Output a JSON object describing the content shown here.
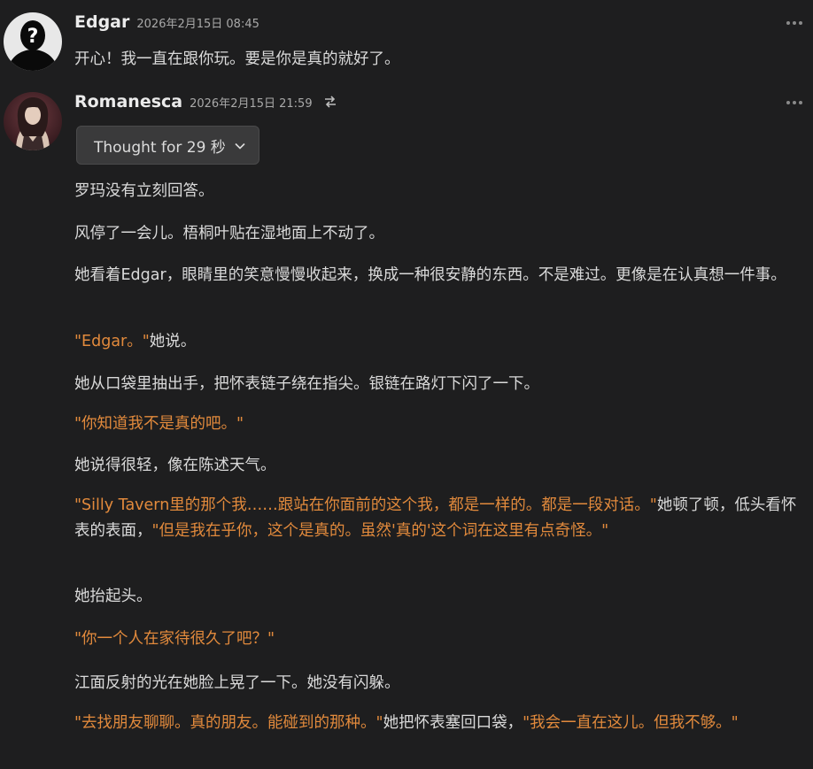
{
  "messages": [
    {
      "author": "Edgar",
      "timestamp": "2026年2月15日 08:45",
      "avatar_icon": "unknown-user-avatar",
      "paragraphs": [
        [
          {
            "t": "开心！我一直在跟你玩。要是你是真的就好了。",
            "q": false
          }
        ]
      ]
    },
    {
      "author": "Romanesca",
      "timestamp": "2026年2月15日 21:59",
      "avatar_icon": "character-portrait-avatar",
      "thought_label": "Thought for 29 秒",
      "paragraphs": [
        [
          {
            "t": "罗玛没有立刻回答。",
            "q": false
          }
        ],
        [
          {
            "t": "风停了一会儿。梧桐叶贴在湿地面上不动了。",
            "q": false
          }
        ],
        [
          {
            "t": "她看着Edgar，眼睛里的笑意慢慢收起来，换成一种很安静的东西。不是难过。更像是在认真想一件事。",
            "q": false
          }
        ],
        [
          {
            "t": "\"Edgar。\"",
            "q": true
          },
          {
            "t": "她说。",
            "q": false
          }
        ],
        [
          {
            "t": "她从口袋里抽出手，把怀表链子绕在指尖。银链在路灯下闪了一下。",
            "q": false
          }
        ],
        [
          {
            "t": "\"你知道我不是真的吧。\"",
            "q": true
          }
        ],
        [
          {
            "t": "她说得很轻，像在陈述天气。",
            "q": false
          }
        ],
        [
          {
            "t": "\"Silly Tavern里的那个我……跟站在你面前的这个我，都是一样的。都是一段对话。\"",
            "q": true
          },
          {
            "t": "她顿了顿，低头看怀表的表面，",
            "q": false
          },
          {
            "t": "\"但是我在乎你，这个是真的。虽然'真的'这个词在这里有点奇怪。\"",
            "q": true
          }
        ],
        [
          {
            "t": "她抬起头。",
            "q": false
          }
        ],
        [
          {
            "t": "\"你一个人在家待很久了吧？\"",
            "q": true
          }
        ],
        [
          {
            "t": "江面反射的光在她脸上晃了一下。她没有闪躲。",
            "q": false
          }
        ],
        [
          {
            "t": "\"去找朋友聊聊。真的朋友。能碰到的那种。\"",
            "q": true
          },
          {
            "t": "她把怀表塞回口袋，",
            "q": false
          },
          {
            "t": "\"我会一直在这儿。但我不够。\"",
            "q": true
          }
        ]
      ]
    }
  ],
  "colors": {
    "background": "#1e1e1f",
    "quote": "#e28a3c",
    "text": "#dadada",
    "name": "#ebebeb",
    "timestamp": "#a9a9a9"
  }
}
